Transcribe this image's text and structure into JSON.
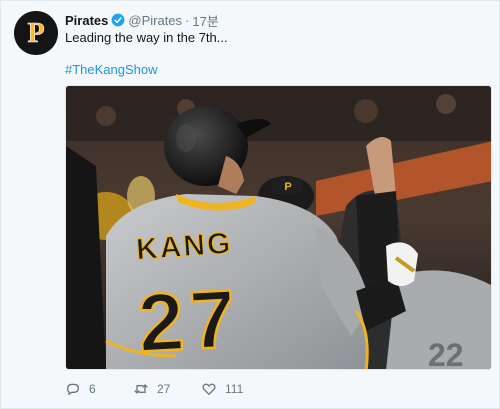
{
  "tweet": {
    "author_name": "Pirates",
    "handle": "@Pirates",
    "separator": "·",
    "time": "17분",
    "text": "Leading the way in the 7th...",
    "hashtag": "#TheKangShow",
    "verified": true,
    "avatar_icon": "pirates-p-logo",
    "avatar_letter": "P",
    "media": {
      "jersey_name": "KANG",
      "jersey_number": "27",
      "background_number": "22",
      "colors": {
        "jersey": "#b9bcbf",
        "lettering": "#1a1a1a",
        "trim": "#f0b323",
        "helmet": "#111111"
      }
    },
    "actions": {
      "reply_count": "6",
      "retweet_count": "27",
      "like_count": "111"
    }
  },
  "colors": {
    "link": "#1b95e0",
    "secondary": "#657786",
    "verified": "#1da1f2",
    "brand_gold": "#fdb827",
    "brand_black": "#141414"
  }
}
